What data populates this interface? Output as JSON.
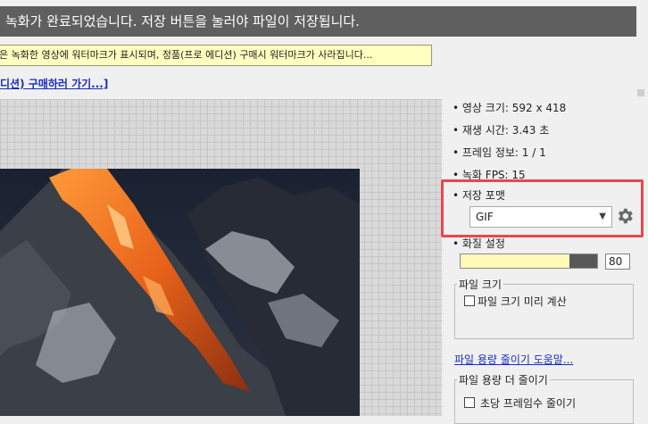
{
  "header": {
    "title": "녹화가 완료되었습니다. 저장 버튼을 눌러야 파일이 저장됩니다."
  },
  "notice": {
    "text": "은 녹화한 영상에 워터마크가 표시되며, 정품(프로 에디션) 구매시 워터마크가 사라집니다...",
    "buy_link": "디션) 구매하러 가기...]"
  },
  "info": {
    "items": [
      "• 영상 크기: 592 x 418",
      "• 재생 시간: 3.43 초",
      "• 프레임 정보: 1 / 1",
      "• 녹화 FPS: 15"
    ]
  },
  "format": {
    "label": "• 저장 포맷",
    "selected": "GIF",
    "caret_icon": "triangle-down-icon",
    "settings_icon": "gear-icon"
  },
  "quality": {
    "label": "• 화질 설정",
    "value": "80",
    "level_percent": 80
  },
  "file_size": {
    "group_title": "파일 크기",
    "precalc_label": "파일 크기 미리 계산",
    "precalc_checked": false
  },
  "help_link": "파일 용량 줄이기 도움말...",
  "reduce": {
    "group_title": "파일 용량 더 줄이기",
    "fps_label": "초당 프레임수 줄이기",
    "fps_checked": false
  },
  "colors": {
    "highlight": "#e8474d",
    "notice_bg": "#ffffc0",
    "link": "#1a2dbd",
    "title_bg": "#5f5f5f"
  }
}
